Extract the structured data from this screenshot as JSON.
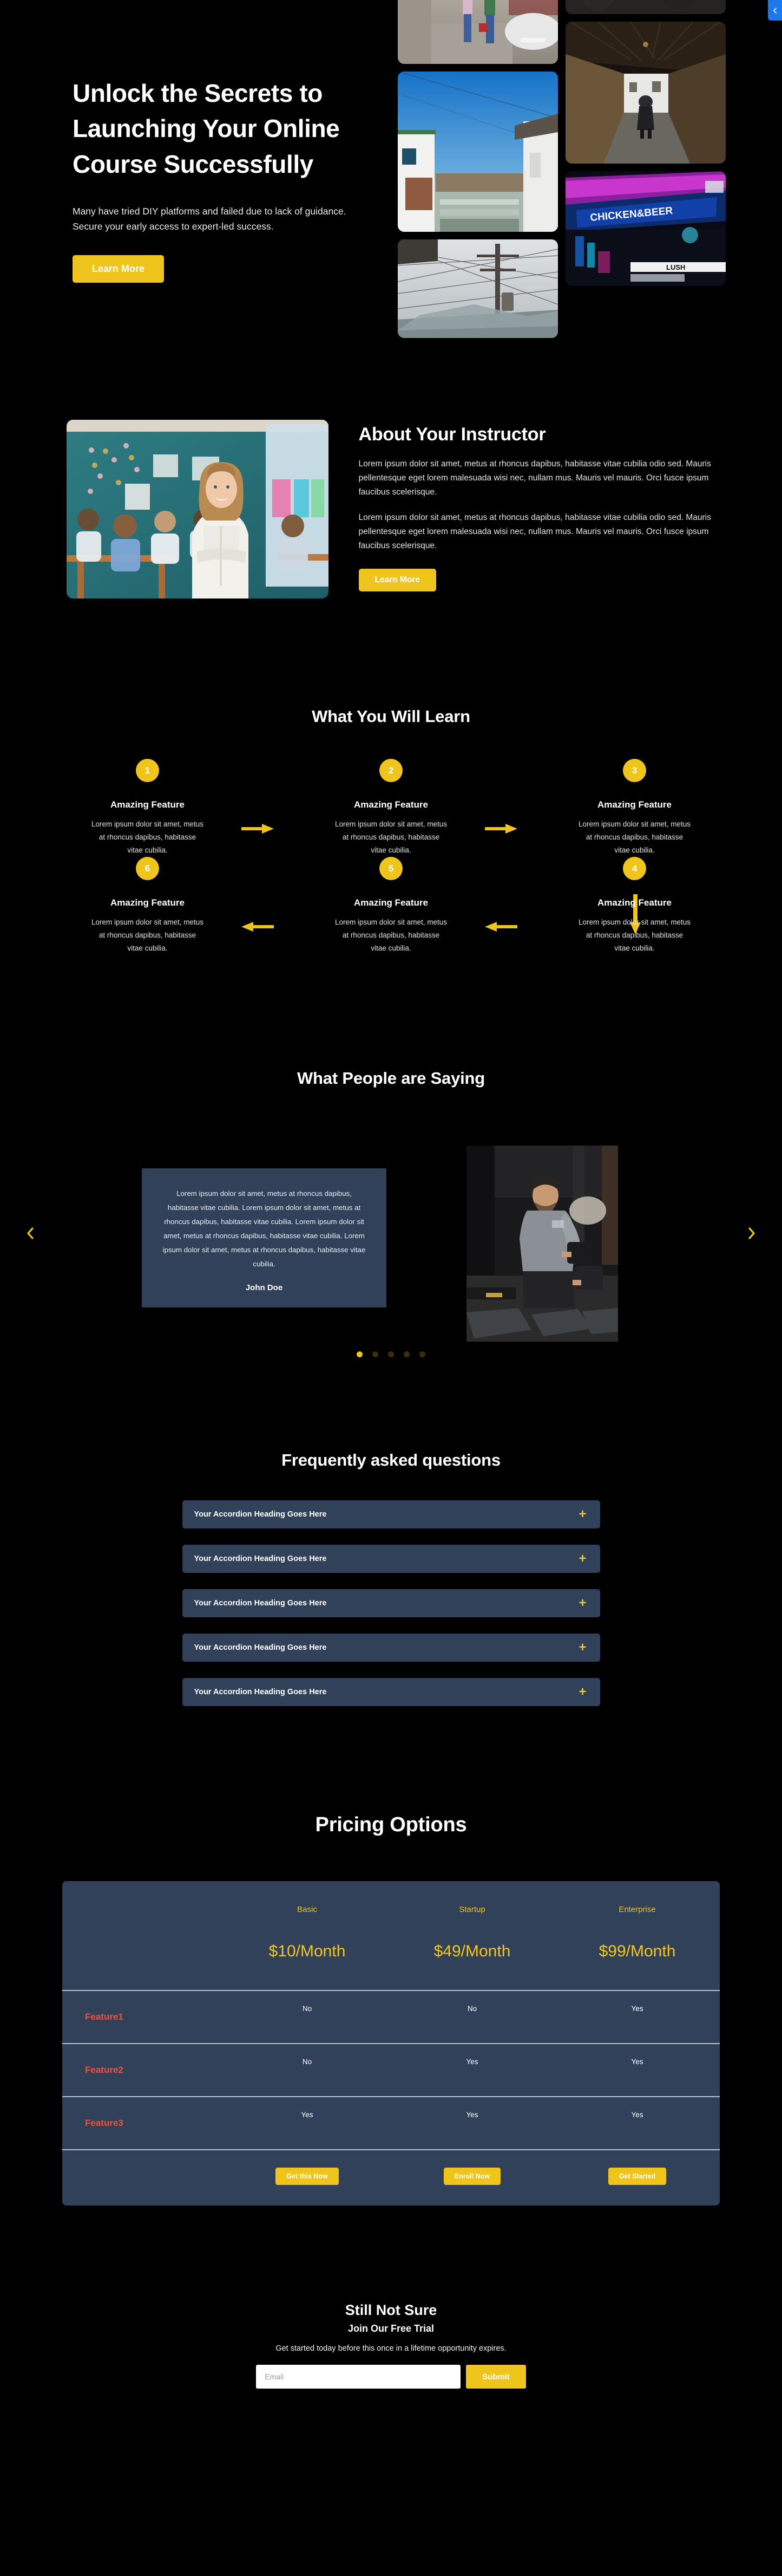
{
  "hero": {
    "title": "Unlock the Secrets to Launching Your Online Course Successfully",
    "subtitle": "Many have tried DIY platforms and failed due to lack of guidance. Secure your early access to expert-led success.",
    "cta_label": "Learn More",
    "edge_tab_icon": "chevron-left-icon",
    "accent_color": "#EFC41C",
    "edge_tab_color": "#1B78EF",
    "images": [
      {
        "alt": "two-people-walking-down-street-with-parked-cars"
      },
      {
        "alt": "blue-sky-alley-between-houses-with-power-lines"
      },
      {
        "alt": "power-pole-and-wires-against-hazy-mountain"
      },
      {
        "alt": "dark-textured-surface"
      },
      {
        "alt": "person-walking-through-covered-wooden-bridge"
      },
      {
        "alt": "neon-signs-chicken-and-beer-lush-at-night"
      }
    ]
  },
  "instructor": {
    "title": "About Your Instructor",
    "image_alt": "smiling-teacher-standing-in-classroom-with-students",
    "paragraphs": [
      "Lorem ipsum dolor sit amet, metus at rhoncus dapibus, habitasse vitae cubilia odio sed. Mauris pellentesque eget lorem malesuada wisi nec, nullam mus. Mauris vel mauris. Orci fusce ipsum faucibus scelerisque.",
      "Lorem ipsum dolor sit amet, metus at rhoncus dapibus, habitasse vitae cubilia odio sed. Mauris pellentesque eget lorem malesuada wisi nec, nullam mus. Mauris vel mauris. Orci fusce ipsum faucibus scelerisque."
    ],
    "cta_label": "Learn More"
  },
  "learn": {
    "title": "What You Will Learn",
    "items": [
      {
        "number": "1",
        "heading": "Amazing Feature",
        "body": "Lorem ipsum dolor sit amet, metus at rhoncus dapibus, habitasse vitae cubilia."
      },
      {
        "number": "2",
        "heading": "Amazing Feature",
        "body": "Lorem ipsum dolor sit amet, metus at rhoncus dapibus, habitasse vitae cubilia."
      },
      {
        "number": "3",
        "heading": "Amazing Feature",
        "body": "Lorem ipsum dolor sit amet, metus at rhoncus dapibus, habitasse vitae cubilia."
      },
      {
        "number": "4",
        "heading": "Amazing Feature",
        "body": "Lorem ipsum dolor sit amet, metus at rhoncus dapibus, habitasse vitae cubilia."
      },
      {
        "number": "5",
        "heading": "Amazing Feature",
        "body": "Lorem ipsum dolor sit amet, metus at rhoncus dapibus, habitasse vitae cubilia."
      },
      {
        "number": "6",
        "heading": "Amazing Feature",
        "body": "Lorem ipsum dolor sit amet, metus at rhoncus dapibus, habitasse vitae cubilia."
      }
    ],
    "arrow_color": "#EFC41C"
  },
  "testimonials": {
    "title": "What People are Saying",
    "quote": "Lorem ipsum dolor sit amet, metus at rhoncus dapibus, habitasse vitae cubilia. Lorem ipsum dolor sit amet, metus at rhoncus dapibus, habitasse vitae cubilia. Lorem ipsum dolor sit amet, metus at rhoncus dapibus, habitasse vitae cubilia. Lorem ipsum dolor sit amet, metus at rhoncus dapibus, habitasse vitae cubilia.",
    "author": "John Doe",
    "image_alt": "man-lifting-dumbbells-in-gym",
    "prev_icon": "chevron-left-icon",
    "next_icon": "chevron-right-icon",
    "card_color": "#31415A",
    "dots": [
      {
        "active": true
      },
      {
        "active": false
      },
      {
        "active": false
      },
      {
        "active": false
      },
      {
        "active": false
      }
    ]
  },
  "faq": {
    "title": "Frequently asked questions",
    "items": [
      {
        "label": "Your Accordion Heading Goes Here",
        "toggle": "+"
      },
      {
        "label": "Your Accordion Heading Goes Here",
        "toggle": "+"
      },
      {
        "label": "Your Accordion Heading Goes Here",
        "toggle": "+"
      },
      {
        "label": "Your Accordion Heading Goes Here",
        "toggle": "+"
      },
      {
        "label": "Your Accordion Heading Goes Here",
        "toggle": "+"
      }
    ]
  },
  "pricing": {
    "title": "Pricing Options",
    "tiers": [
      "Basic",
      "Startup",
      "Enterprise"
    ],
    "prices": [
      "$10/Month",
      "$49/Month",
      "$99/Month"
    ],
    "features": [
      {
        "name": "Feature1",
        "values": [
          "No",
          "No",
          "Yes"
        ]
      },
      {
        "name": "Feature2",
        "values": [
          "No",
          "Yes",
          "Yes"
        ]
      },
      {
        "name": "Feature3",
        "values": [
          "Yes",
          "Yes",
          "Yes"
        ]
      }
    ],
    "buttons": [
      "Get this Now",
      "Enroll Now",
      "Get Started"
    ]
  },
  "cta": {
    "heading": "Still Not Sure",
    "subheading": "Join Our Free Trial",
    "text": "Get started today before this once in a lifetime opportunity expires.",
    "email_placeholder": "Email",
    "email_value": "",
    "submit_label": "Submit"
  }
}
